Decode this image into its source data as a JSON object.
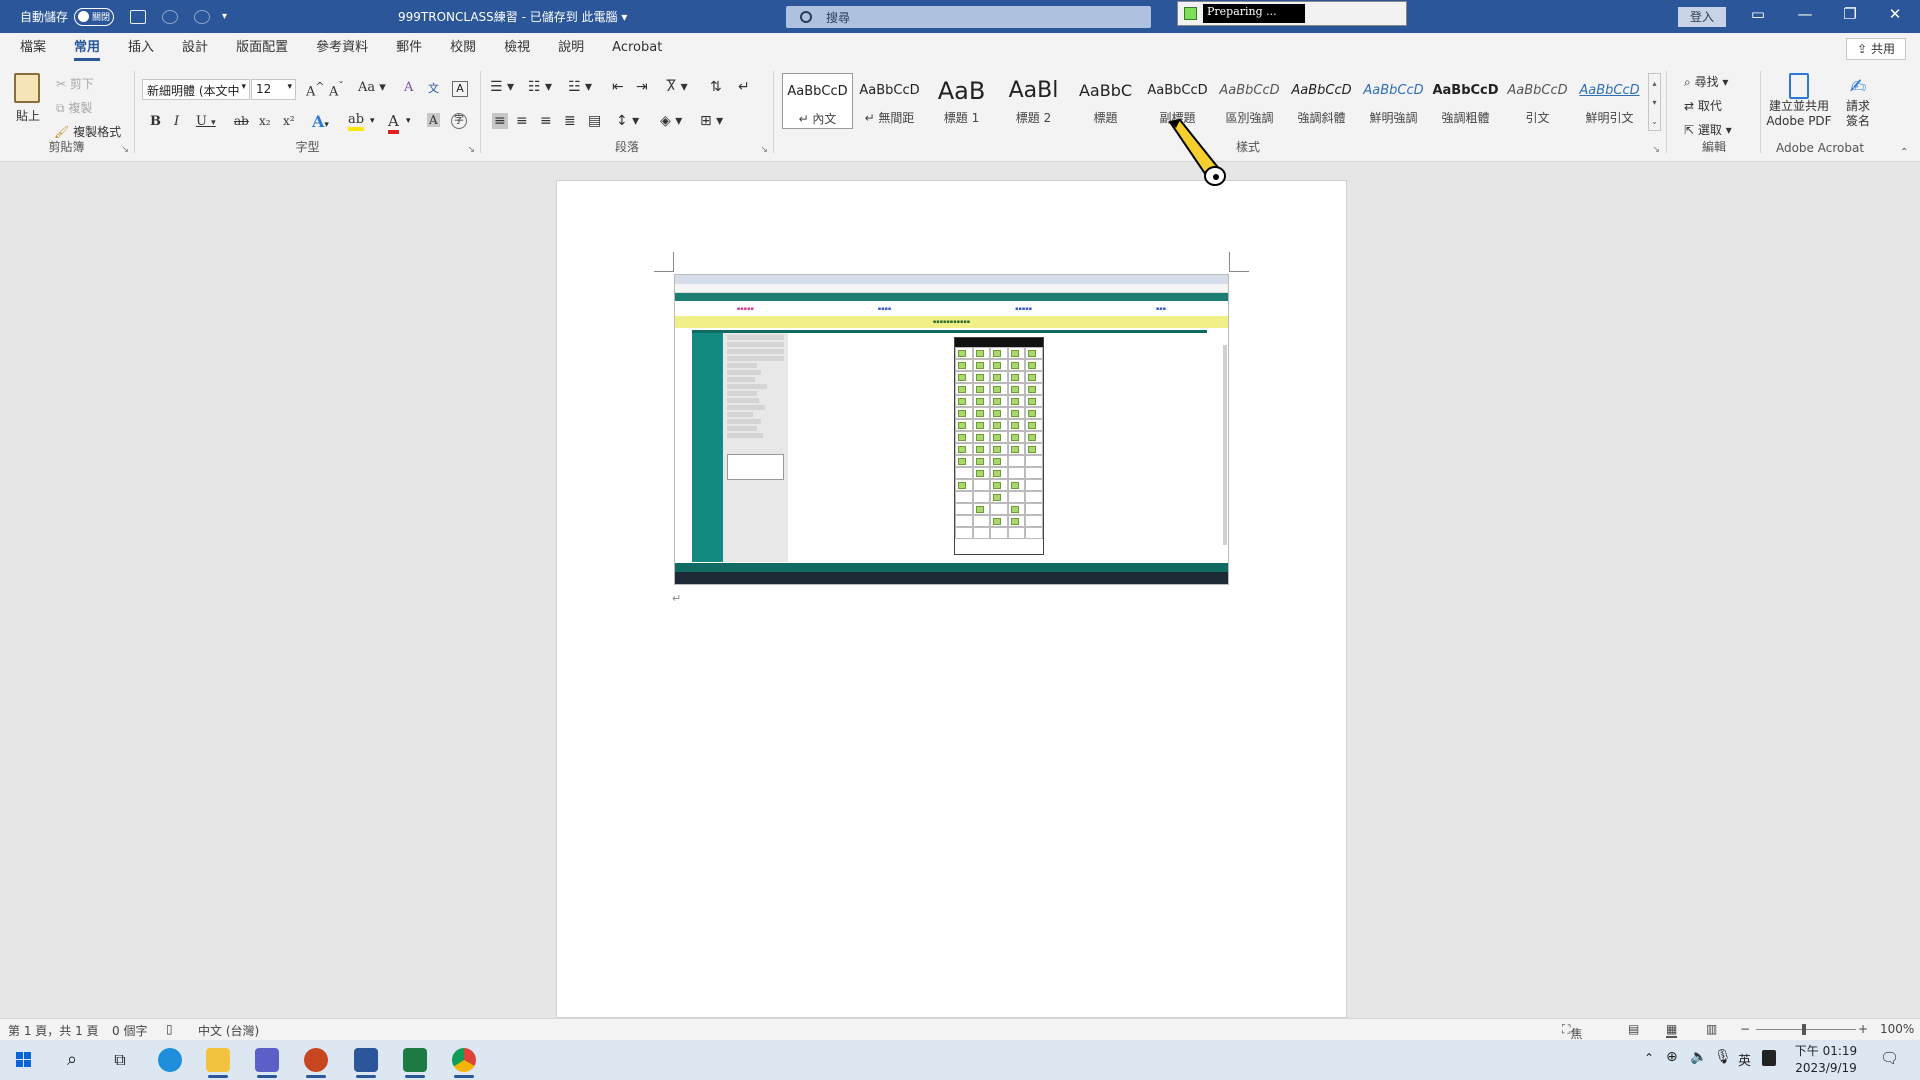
{
  "titlebar": {
    "autosave_label": "自動儲存",
    "autosave_state": "關閉",
    "doc_title": "999TRONCLASS練習 - 已儲存到 此電腦",
    "search_placeholder": "搜尋",
    "signin": "登入",
    "preparing_text": "Preparing ..."
  },
  "tabs": [
    "檔案",
    "常用",
    "插入",
    "設計",
    "版面配置",
    "參考資料",
    "郵件",
    "校閱",
    "檢視",
    "說明",
    "Acrobat"
  ],
  "active_tab": "常用",
  "share_label": "共用",
  "clipboard": {
    "paste": "貼上",
    "cut": "剪下",
    "copy": "複製",
    "format_painter": "複製格式",
    "group_label": "剪貼簿"
  },
  "font": {
    "font_name": "新細明體 (本文中",
    "font_size": "12",
    "change_case": "Aa",
    "group_label": "字型",
    "bold": "B",
    "italic": "I",
    "underline": "U",
    "strikethrough": "ab",
    "subscript": "x₂",
    "superscript": "x²",
    "text_effects": "A",
    "highlight": "ab",
    "font_color": "A",
    "char_shading": "A",
    "enclose": "字",
    "grow_font": "A",
    "shrink_font": "A",
    "clear_format": "A",
    "phonetic": "文",
    "char_border": "A"
  },
  "paragraph": {
    "group_label": "段落"
  },
  "styles": {
    "group_label": "樣式",
    "items": [
      {
        "sample": "AaBbCcD",
        "name": "↵ 內文"
      },
      {
        "sample": "AaBbCcD",
        "name": "↵ 無間距"
      },
      {
        "sample": "AaB",
        "name": "標題 1"
      },
      {
        "sample": "AaBl",
        "name": "標題 2"
      },
      {
        "sample": "AaBbC",
        "name": "標題"
      },
      {
        "sample": "AaBbCcD",
        "name": "副標題"
      },
      {
        "sample": "AaBbCcD",
        "name": "區別強調"
      },
      {
        "sample": "AaBbCcD",
        "name": "強調斜體"
      },
      {
        "sample": "AaBbCcD",
        "name": "鮮明強調"
      },
      {
        "sample": "AaBbCcD",
        "name": "強調粗體"
      },
      {
        "sample": "AaBbCcD",
        "name": "引文"
      },
      {
        "sample": "AaBbCcD",
        "name": "鮮明引文"
      }
    ]
  },
  "editing": {
    "find": "尋找",
    "replace": "取代",
    "select": "選取",
    "group_label": "編輯"
  },
  "acrobat": {
    "create_share_1": "建立並共用",
    "create_share_2": "Adobe PDF",
    "request_sign_1": "請求",
    "request_sign_2": "簽名",
    "group_label": "Adobe Acrobat"
  },
  "statusbar": {
    "page": "第 1 頁，共 1 頁",
    "words": "0 個字",
    "language": "中文 (台灣)",
    "focus": "焦點",
    "zoom": "100%"
  },
  "clock": {
    "time": "下午 01:19",
    "date": "2023/9/19"
  },
  "tray": {
    "ime": "英"
  },
  "colors": {
    "word_blue": "#2b579a",
    "embedded_teal": "#128a80",
    "embedded_yellow": "#f1ef88"
  }
}
